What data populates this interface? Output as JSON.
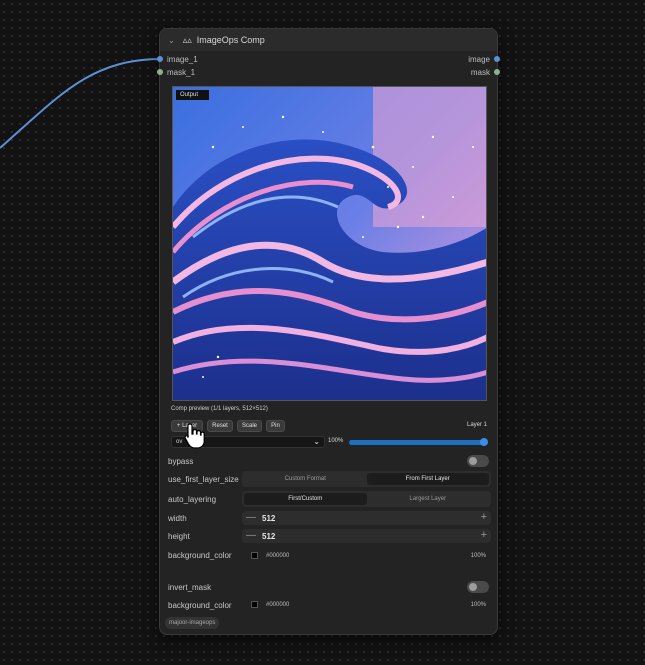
{
  "node": {
    "title": "ImageOps Comp",
    "inputs": [
      {
        "label": "image_1",
        "color": "#5b8fd6"
      },
      {
        "label": "mask_1",
        "color": "#8fb08f"
      }
    ],
    "outputs": [
      {
        "label": "image",
        "color": "#5b8fd6"
      },
      {
        "label": "mask",
        "color": "#8fb08f"
      }
    ],
    "preview_badge": "Output",
    "comp_caption": "Comp preview (1/1 layers, 512×512)",
    "buttons": {
      "add_layer": "+ Layer",
      "reset": "Reset",
      "scale": "Scale",
      "pin": "Pin"
    },
    "layer_label": "Layer 1",
    "blend_select_value": "ov",
    "opacity_value": "100%",
    "opacity_fraction": 1.0,
    "bypass": {
      "label": "bypass",
      "on": false
    },
    "use_first_layer_size": {
      "label": "use_first_layer_size",
      "options": [
        "Custom Format",
        "From First Layer"
      ],
      "selected": "From First Layer"
    },
    "auto_layering": {
      "label": "auto_layering",
      "options": [
        "First/Custom",
        "Largest Layer"
      ],
      "selected": "First/Custom"
    },
    "width": {
      "label": "width",
      "value": "512"
    },
    "height": {
      "label": "height",
      "value": "512"
    },
    "background_color_1": {
      "label": "background_color",
      "hex": "#000000",
      "alpha": "100%"
    },
    "invert_mask": {
      "label": "invert_mask",
      "on": false
    },
    "background_color_2": {
      "label": "background_color",
      "hex": "#000000",
      "alpha": "100%"
    },
    "tag": "majoor-imageops",
    "icons": {
      "collapse": "chevron-down-icon",
      "logo": "node-logo-icon",
      "minus": "minus-icon",
      "plus": "plus-icon",
      "cursor": "hand-pointer-icon"
    },
    "colors": {
      "accent": "#1f6fc1",
      "node_bg": "#232323",
      "wire": "#5b8fd6"
    }
  }
}
